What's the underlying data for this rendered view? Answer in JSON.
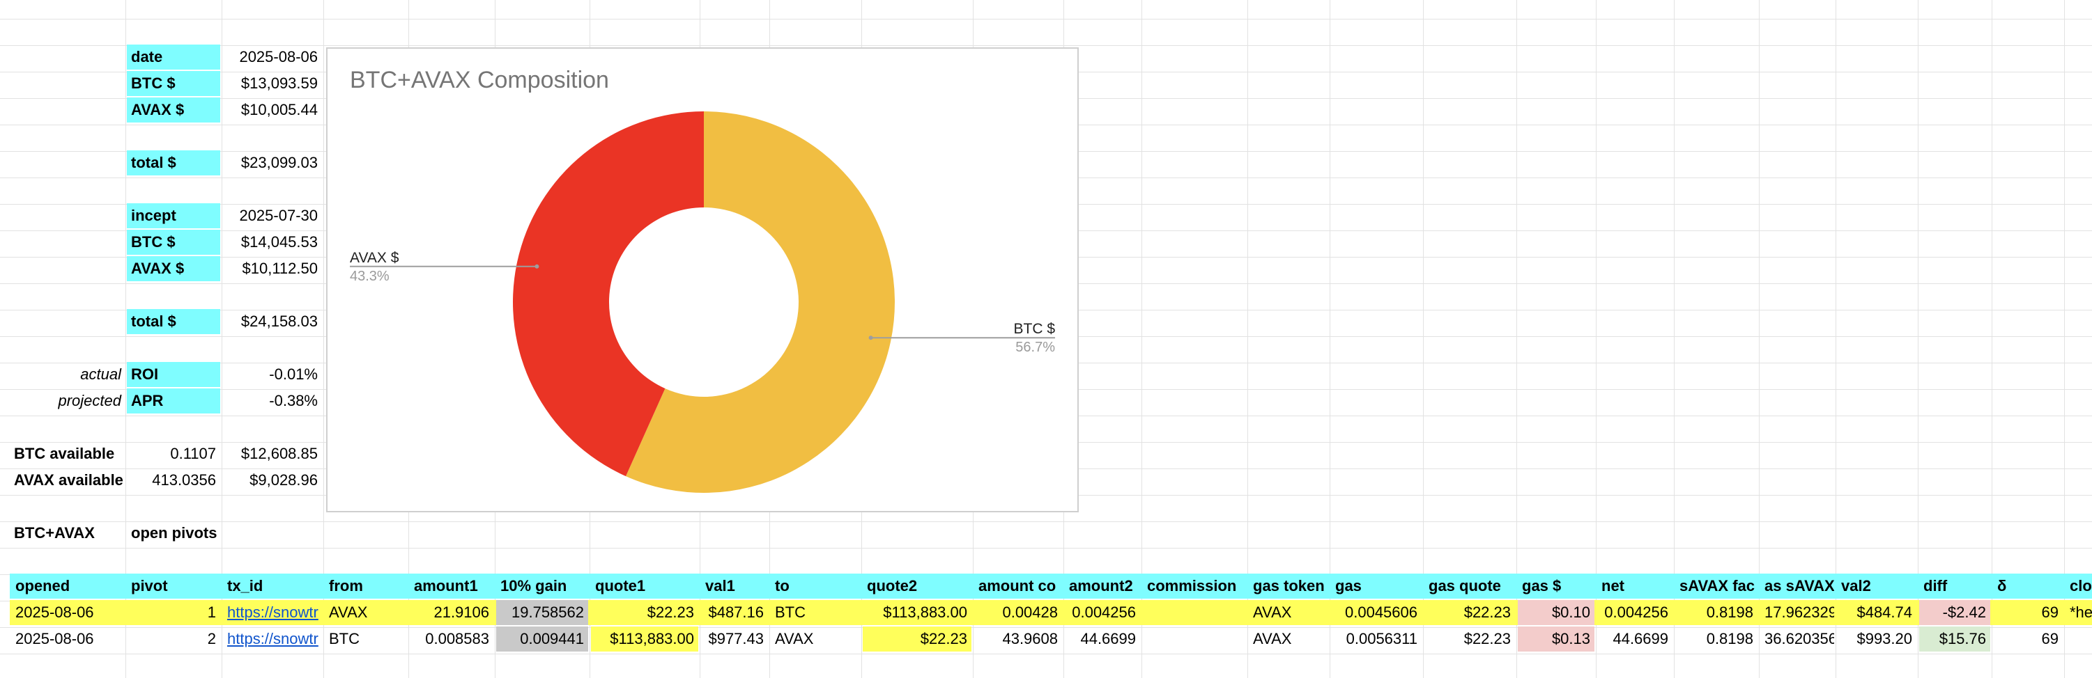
{
  "summary": {
    "date_label": "date",
    "date_value": "2025-08-06",
    "btc_label": "BTC $",
    "btc_value": "$13,093.59",
    "avax_label": "AVAX $",
    "avax_value": "$10,005.44",
    "total_label": "total $",
    "total_value": "$23,099.03",
    "incept_label": "incept",
    "incept_value": "2025-07-30",
    "incept_btc_label": "BTC $",
    "incept_btc_value": "$14,045.53",
    "incept_avax_label": "AVAX $",
    "incept_avax_value": "$10,112.50",
    "incept_total_label": "total $",
    "incept_total_value": "$24,158.03",
    "roi_prefix": "actual",
    "roi_label": "ROI",
    "roi_value": "-0.01%",
    "apr_prefix": "projected",
    "apr_label": "APR",
    "apr_value": "-0.38%",
    "btc_available_label": "BTC available",
    "btc_available_qty": "0.1107",
    "btc_available_usd": "$12,608.85",
    "avax_available_label": "AVAX available",
    "avax_available_qty": "413.0356",
    "avax_available_usd": "$9,028.96",
    "section_label": "BTC+AVAX",
    "open_pivots_label": "open pivots"
  },
  "chart_data": {
    "type": "pie",
    "title": "BTC+AVAX Composition",
    "donut": true,
    "labels": [
      "BTC $",
      "AVAX $"
    ],
    "values": [
      56.7,
      43.3
    ],
    "value_labels": [
      "56.7%",
      "43.3%"
    ],
    "colors": [
      "#f1be42",
      "#ea3425"
    ],
    "legend": "labeled-leaders"
  },
  "table": {
    "headers": [
      "opened",
      "pivot",
      "tx_id",
      "from",
      "amount1",
      "10% gain",
      "quote1",
      "val1",
      "to",
      "quote2",
      "amount co",
      "amount2",
      "commission",
      "gas token",
      "gas",
      "gas quote",
      "gas $",
      "net",
      "sAVAX fac",
      "as sAVAX",
      "val2",
      "diff",
      "δ",
      "clo"
    ],
    "rows": [
      [
        "2025-08-06",
        "1",
        "https://snowtr",
        "AVAX",
        "21.9106",
        "19.758562",
        "$22.23",
        "$487.16",
        "BTC",
        "$113,883.00",
        "0.00428",
        "0.004256",
        "",
        "AVAX",
        "0.0045606",
        "$22.23",
        "$0.10",
        "0.004256",
        "0.8198",
        "17.962329",
        "$484.74",
        "-$2.42",
        "69",
        "*he"
      ],
      [
        "2025-08-06",
        "2",
        "https://snowtr",
        "BTC",
        "0.008583",
        "0.009441",
        "$113,883.00",
        "$977.43",
        "AVAX",
        "$22.23",
        "43.9608",
        "44.6699",
        "",
        "AVAX",
        "0.0056311",
        "$22.23",
        "$0.13",
        "44.6699",
        "0.8198",
        "36.620356",
        "$993.20",
        "$15.76",
        "69",
        ""
      ]
    ]
  }
}
